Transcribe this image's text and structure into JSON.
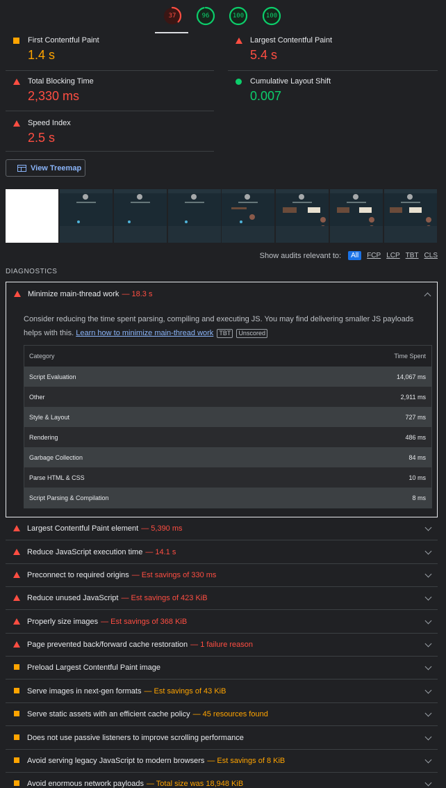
{
  "gauges": [
    {
      "score": "37",
      "color": "#ff4e42",
      "fraction": 0.37
    },
    {
      "score": "96",
      "color": "#0cce6b",
      "fraction": 0.96
    },
    {
      "score": "100",
      "color": "#0cce6b",
      "fraction": 1.0
    },
    {
      "score": "100",
      "color": "#0cce6b",
      "fraction": 1.0
    }
  ],
  "metrics": {
    "fcp": {
      "name": "First Contentful Paint",
      "value": "1.4 s",
      "status": "average",
      "color": "#ffa400"
    },
    "lcp": {
      "name": "Largest Contentful Paint",
      "value": "5.4 s",
      "status": "fail",
      "color": "#ff4e42"
    },
    "tbt": {
      "name": "Total Blocking Time",
      "value": "2,330 ms",
      "status": "fail",
      "color": "#ff4e42"
    },
    "cls": {
      "name": "Cumulative Layout Shift",
      "value": "0.007",
      "status": "pass",
      "color": "#0cce6b"
    },
    "si": {
      "name": "Speed Index",
      "value": "2.5 s",
      "status": "fail",
      "color": "#ff4e42"
    }
  },
  "treemap_button": "View Treemap",
  "relevant": {
    "label": "Show audits relevant to:",
    "filters": [
      "All",
      "FCP",
      "LCP",
      "TBT",
      "CLS"
    ],
    "active": "All"
  },
  "diagnostics_title": "DIAGNOSTICS",
  "expanded_audit": {
    "title": "Minimize main-thread work",
    "display_value": "— 18.3 s",
    "description": "Consider reducing the time spent parsing, compiling and executing JS. You may find delivering smaller JS payloads helps with this.",
    "link_text": "Learn how to minimize main-thread work",
    "badges": [
      "TBT",
      "Unscored"
    ],
    "table": {
      "headers": [
        "Category",
        "Time Spent"
      ],
      "rows": [
        {
          "category": "Script Evaluation",
          "time": "14,067 ms"
        },
        {
          "category": "Other",
          "time": "2,911 ms"
        },
        {
          "category": "Style & Layout",
          "time": "727 ms"
        },
        {
          "category": "Rendering",
          "time": "486 ms"
        },
        {
          "category": "Garbage Collection",
          "time": "84 ms"
        },
        {
          "category": "Parse HTML & CSS",
          "time": "10 ms"
        },
        {
          "category": "Script Parsing & Compilation",
          "time": "8 ms"
        }
      ]
    }
  },
  "audits": [
    {
      "title": "Largest Contentful Paint element",
      "display_value": "— 5,390 ms",
      "status": "fail"
    },
    {
      "title": "Reduce JavaScript execution time",
      "display_value": "— 14.1 s",
      "status": "fail"
    },
    {
      "title": "Preconnect to required origins",
      "display_value": "— Est savings of 330 ms",
      "status": "fail"
    },
    {
      "title": "Reduce unused JavaScript",
      "display_value": "— Est savings of 423 KiB",
      "status": "fail"
    },
    {
      "title": "Properly size images",
      "display_value": "— Est savings of 368 KiB",
      "status": "fail"
    },
    {
      "title": "Page prevented back/forward cache restoration",
      "display_value": "— 1 failure reason",
      "status": "fail"
    },
    {
      "title": "Preload Largest Contentful Paint image",
      "display_value": "",
      "status": "average"
    },
    {
      "title": "Serve images in next-gen formats",
      "display_value": "— Est savings of 43 KiB",
      "status": "average"
    },
    {
      "title": "Serve static assets with an efficient cache policy",
      "display_value": "— 45 resources found",
      "status": "average"
    },
    {
      "title": "Does not use passive listeners to improve scrolling performance",
      "display_value": "",
      "status": "average"
    },
    {
      "title": "Avoid serving legacy JavaScript to modern browsers",
      "display_value": "— Est savings of 8 KiB",
      "status": "average"
    },
    {
      "title": "Avoid enormous network payloads",
      "display_value": "— Total size was 18,948 KiB",
      "status": "average"
    }
  ]
}
